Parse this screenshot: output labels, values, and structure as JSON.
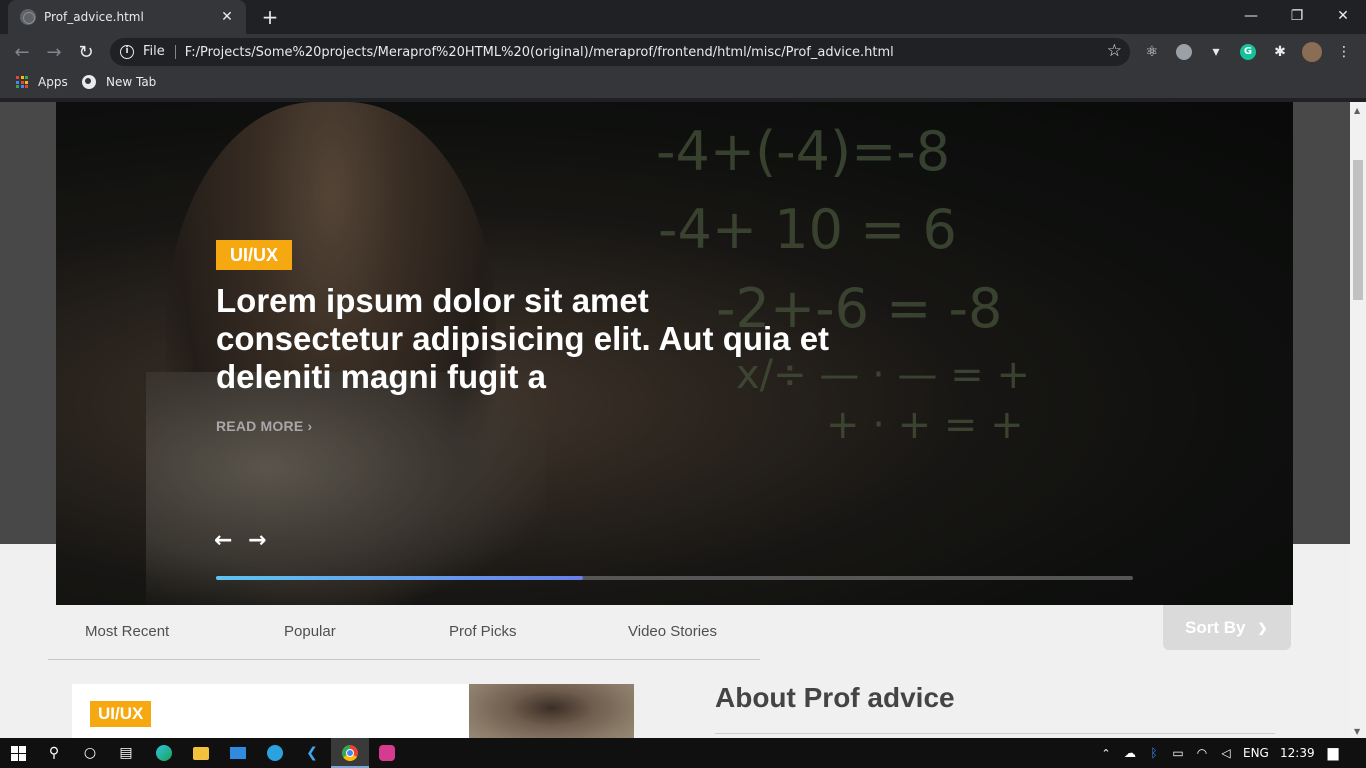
{
  "browser": {
    "tab_title": "Prof_advice.html",
    "omnibox_scheme": "File",
    "url": "F:/Projects/Some%20projects/Meraprof%20HTML%20(original)/meraprof/frontend/html/misc/Prof_advice.html",
    "bookmarks": [
      "Apps",
      "New Tab"
    ]
  },
  "hero": {
    "category": "UI/UX",
    "title": "Lorem ipsum dolor sit amet consectetur adipisicing elit. Aut quia et deleniti magni fugit a",
    "read_more": "READ MORE",
    "chalk_lines": [
      "-4+(-4)=-8",
      "-4+ 10 = 6",
      "-2+-6 = -8",
      "x/÷ — · — = +",
      "+ · + = +"
    ],
    "progress": 0.4
  },
  "filters": {
    "tabs": [
      "Most Recent",
      "Popular",
      "Prof Picks",
      "Video Stories"
    ],
    "sort_label": "Sort By"
  },
  "card": {
    "category": "UI/UX"
  },
  "sidebar": {
    "about_title": "About Prof advice"
  },
  "taskbar": {
    "language": "ENG",
    "time": "12:39"
  },
  "colors": {
    "accent": "#f5a80f",
    "progress_start": "#5ec4f0",
    "progress_end": "#6a7fe8"
  }
}
